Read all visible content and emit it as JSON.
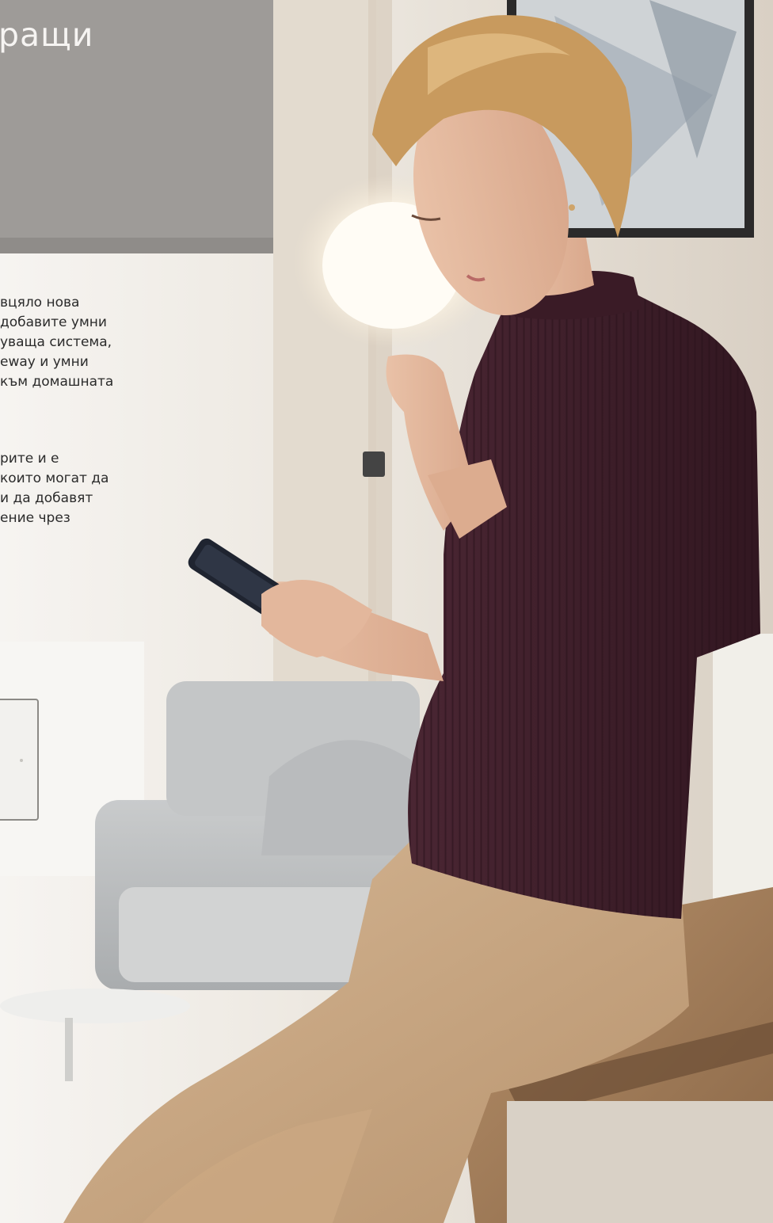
{
  "heading": "ращи",
  "paragraphs": [
    {
      "lines": [
        "вцяло нова",
        "добавите умни",
        "уваща система,",
        "eway и умни",
        "към домашната"
      ]
    },
    {
      "lines": [
        "рите и е",
        "които могат да",
        "и да добавят",
        "ение чрез"
      ]
    }
  ],
  "colors": {
    "wall": "#efece6",
    "sweater": "#3f1f2a",
    "trousers": "#c9a784",
    "hair": "#c89a5e",
    "panel": "#f7f6f3"
  }
}
